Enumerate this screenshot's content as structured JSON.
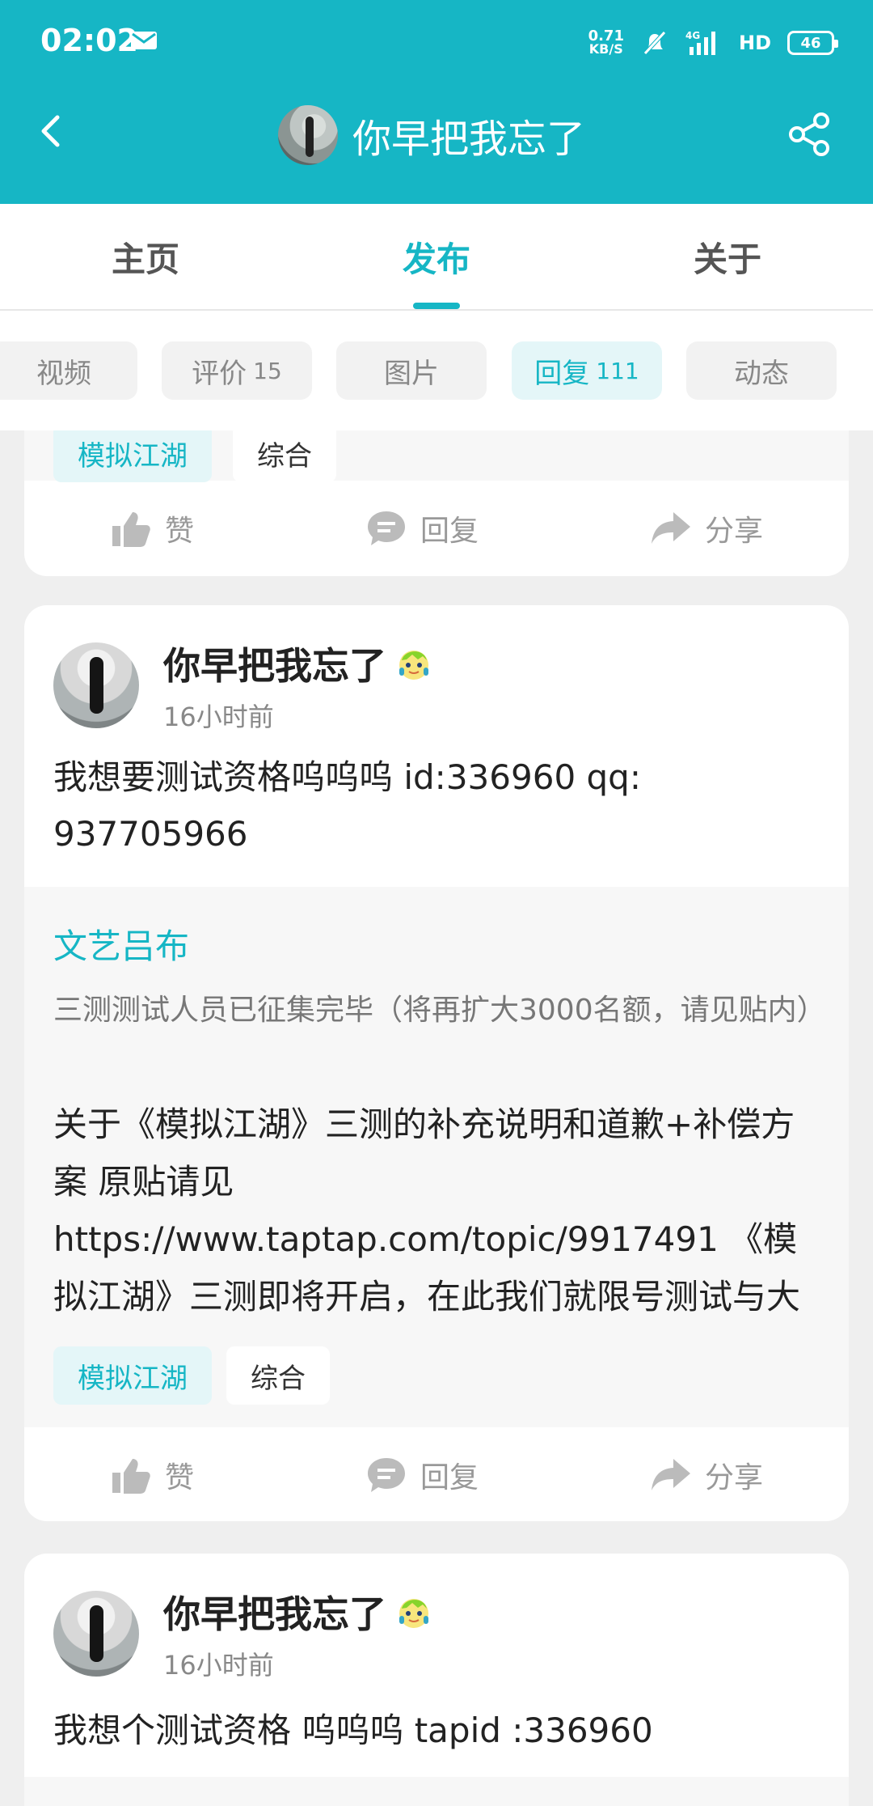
{
  "status_bar": {
    "time": "02:02",
    "net_speed": "0.71",
    "net_unit": "KB/S",
    "signal_label": "4G",
    "hd_label": "HD",
    "battery": "46"
  },
  "header": {
    "title": "你早把我忘了"
  },
  "main_tabs": [
    {
      "label": "主页"
    },
    {
      "label": "发布"
    },
    {
      "label": "关于"
    }
  ],
  "filters": [
    {
      "label": "视频",
      "count": ""
    },
    {
      "label": "评价",
      "count": "15"
    },
    {
      "label": "图片",
      "count": ""
    },
    {
      "label": "回复",
      "count": "111"
    },
    {
      "label": "动态",
      "count": ""
    }
  ],
  "actions": {
    "like": "赞",
    "reply": "回复",
    "share": "分享"
  },
  "posts": [
    {
      "author": "你早把我忘了",
      "time": "16小时前",
      "text": "我想要测试资格呜呜呜   id:336960   qq:\n937705966",
      "quote": {
        "author": "文艺吕布",
        "title": "三测测试人员已征集完毕（将再扩大3000名额，请见贴内）",
        "body": "关于《模拟江湖》三测的补充说明和道歉+补偿方案 原贴请见 https://www.taptap.com/topic/9917491 《模拟江湖》三测即将开启，在此我们就限号测试与大家沟通不充分表示道歉，希…",
        "tags": [
          "模拟江湖",
          "综合"
        ]
      }
    },
    {
      "author": "你早把我忘了",
      "time": "16小时前",
      "text": "我想个测试资格 呜呜呜   tapid :336960"
    }
  ],
  "colors": {
    "accent": "#16b6c5",
    "background": "#efefef"
  }
}
